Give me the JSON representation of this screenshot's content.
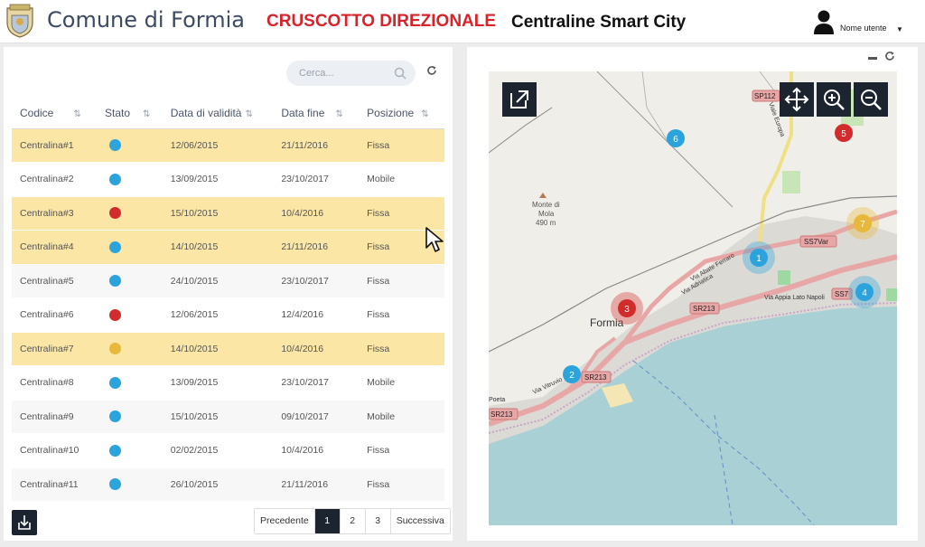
{
  "header": {
    "comune": "Comune di Formia",
    "cruscotto": "CRUSCOTTO DIREZIONALE",
    "subtitle": "Centraline Smart City",
    "user_label": "Nome utente",
    "user_icon": "user-icon"
  },
  "table": {
    "search_placeholder": "Cerca...",
    "columns": [
      "Codice",
      "Stato",
      "Data di validità",
      "Data fine",
      "Posizione"
    ],
    "rows": [
      {
        "codice": "Centralina#1",
        "stato": "blue",
        "validita": "12/06/2015",
        "fine": "21/11/2016",
        "posizione": "Fissa",
        "highlight": true
      },
      {
        "codice": "Centralina#2",
        "stato": "blue",
        "validita": "13/09/2015",
        "fine": "23/10/2017",
        "posizione": "Mobile",
        "highlight": false
      },
      {
        "codice": "Centralina#3",
        "stato": "red",
        "validita": "15/10/2015",
        "fine": "10/4/2016",
        "posizione": "Fissa",
        "highlight": true
      },
      {
        "codice": "Centralina#4",
        "stato": "blue",
        "validita": "14/10/2015",
        "fine": "21/11/2016",
        "posizione": "Fissa",
        "highlight": true
      },
      {
        "codice": "Centralina#5",
        "stato": "blue",
        "validita": "24/10/2015",
        "fine": "23/10/2017",
        "posizione": "Fissa",
        "highlight": false
      },
      {
        "codice": "Centralina#6",
        "stato": "red",
        "validita": "12/06/2015",
        "fine": "12/4/2016",
        "posizione": "Fissa",
        "highlight": false
      },
      {
        "codice": "Centralina#7",
        "stato": "yellow",
        "validita": "14/10/2015",
        "fine": "10/4/2016",
        "posizione": "Fissa",
        "highlight": true
      },
      {
        "codice": "Centralina#8",
        "stato": "blue",
        "validita": "13/09/2015",
        "fine": "23/10/2017",
        "posizione": "Mobile",
        "highlight": false
      },
      {
        "codice": "Centralina#9",
        "stato": "blue",
        "validita": "15/10/2015",
        "fine": "09/10/2017",
        "posizione": "Mobile",
        "highlight": false
      },
      {
        "codice": "Centralina#10",
        "stato": "blue",
        "validita": "02/02/2015",
        "fine": "10/4/2016",
        "posizione": "Fissa",
        "highlight": false
      },
      {
        "codice": "Centralina#11",
        "stato": "blue",
        "validita": "26/10/2015",
        "fine": "21/11/2016",
        "posizione": "Fissa",
        "highlight": false
      }
    ],
    "status_colors": {
      "blue": "#2ba3dc",
      "red": "#d12b2b",
      "yellow": "#e8b83a"
    }
  },
  "pagination": {
    "prev": "Precedente",
    "pages": [
      "1",
      "2",
      "3"
    ],
    "active": "1",
    "next": "Successiva"
  },
  "map": {
    "labels": {
      "mountain": "Monte di",
      "mountain2": "Mola",
      "elevation": "490 m",
      "city": "Formia",
      "road1": "SS7Var",
      "road2": "SR213",
      "road3": "SR213",
      "road4": "SR213",
      "road5": "SS7",
      "road6": "SP112",
      "street1": "Via Appia Lato Napoli",
      "street2": "Via Vitruvio",
      "street3": "Via Adriatica",
      "street4": "Via Abate Ferraro",
      "street5": "Viale Europa",
      "street6": "Poeta"
    },
    "markers": [
      {
        "n": "1",
        "color": "#2ba3dc"
      },
      {
        "n": "2",
        "color": "#2ba3dc"
      },
      {
        "n": "3",
        "color": "#d12b2b"
      },
      {
        "n": "4",
        "color": "#2ba3dc"
      },
      {
        "n": "5",
        "color": "#d12b2b"
      },
      {
        "n": "6",
        "color": "#2ba3dc"
      },
      {
        "n": "7",
        "color": "#e8b83a"
      }
    ]
  }
}
